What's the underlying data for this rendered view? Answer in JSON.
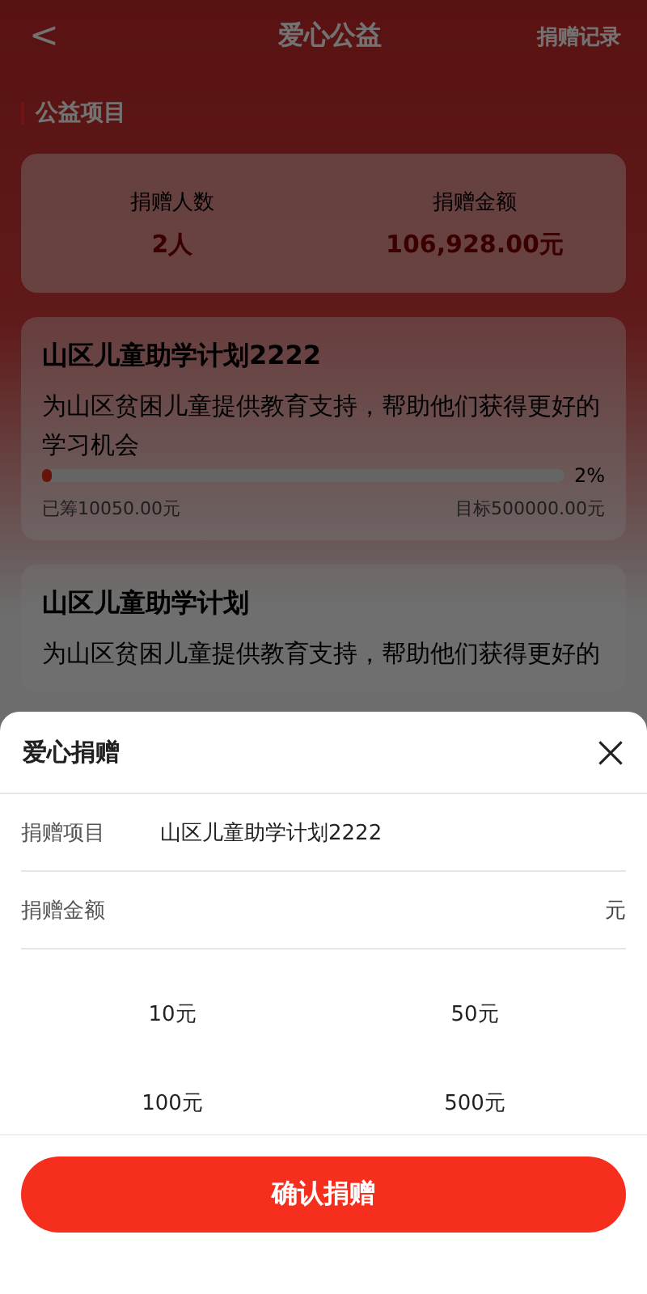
{
  "header": {
    "back": "<",
    "title": "爱心公益",
    "action": "捐赠记录"
  },
  "section_title": "公益项目",
  "stats": [
    {
      "label": "捐赠人数",
      "value": "2人"
    },
    {
      "label": "捐赠金额",
      "value": "106,928.00元"
    }
  ],
  "projects": [
    {
      "title": "山区儿童助学计划2222",
      "description": "为山区贫困儿童提供教育支持，帮助他们获得更好的学习机会",
      "level": 0.02,
      "percent": "2%",
      "raised": "已筹10050.00元",
      "target": "目标500000.00元"
    },
    {
      "title": "山区儿童助学计划",
      "description": "为山区贫困儿童提供教育支持，帮助他们获得更好的"
    }
  ],
  "sheet": {
    "title": "爱心捐赠",
    "project": {
      "label": "捐赠项目",
      "value": "山区儿童助学计划2222"
    },
    "amount": {
      "label": "捐赠金额",
      "unit": "元"
    },
    "presets": [
      "10元",
      "50元",
      "100元",
      "500元"
    ],
    "confirm": "确认捐赠"
  }
}
